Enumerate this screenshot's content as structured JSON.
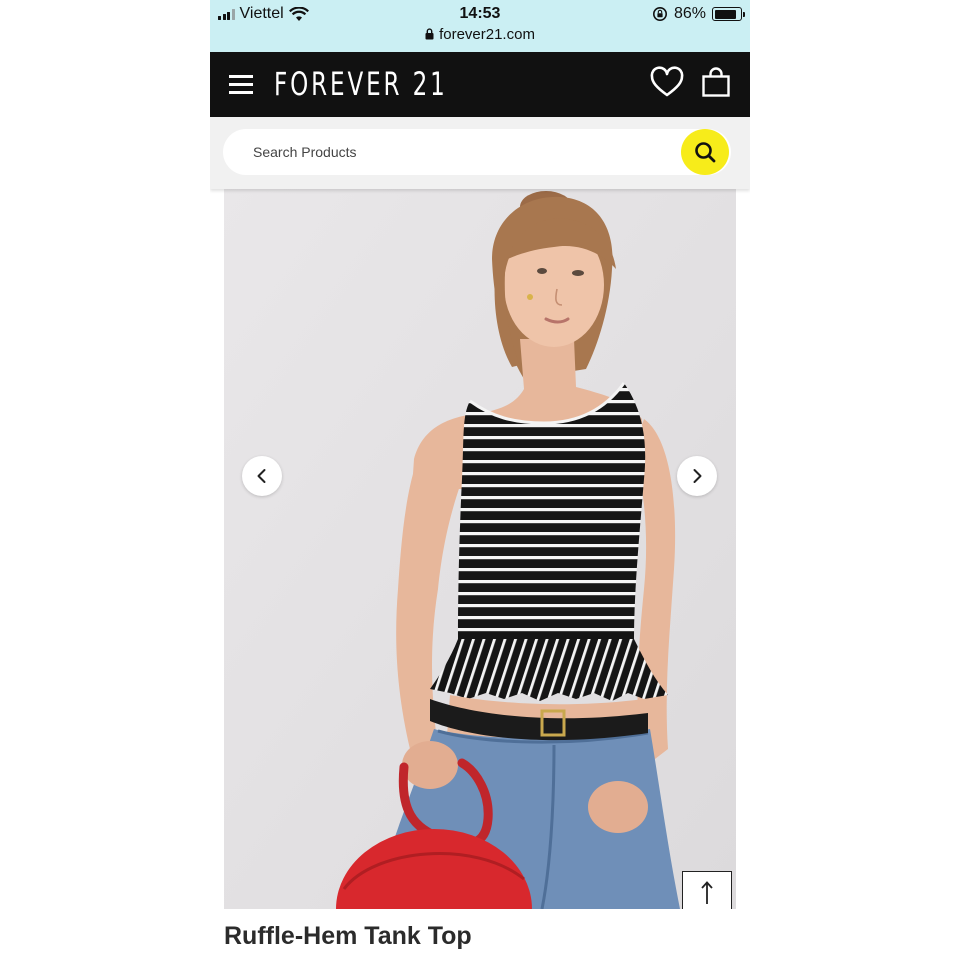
{
  "status_bar": {
    "carrier": "Viettel",
    "time": "14:53",
    "url": "forever21.com",
    "battery": "86%",
    "battery_level": 0.86,
    "icons": [
      "signal-icon",
      "wifi-icon",
      "lock-icon",
      "orientation-lock-icon",
      "battery-icon"
    ]
  },
  "header": {
    "logo": "FOREVER 21",
    "icons": [
      "menu-icon",
      "heart-icon",
      "shopping-bag-icon"
    ],
    "background_color": "#111111"
  },
  "search": {
    "placeholder": "Search Products",
    "value": "",
    "button_icon": "search-icon",
    "button_color": "#f7ec1a"
  },
  "gallery": {
    "prev_icon": "chevron-left-icon",
    "next_icon": "chevron-right-icon",
    "back_to_top_icon": "arrow-up-icon"
  },
  "product": {
    "title": "Ruffle-Hem Tank Top"
  }
}
